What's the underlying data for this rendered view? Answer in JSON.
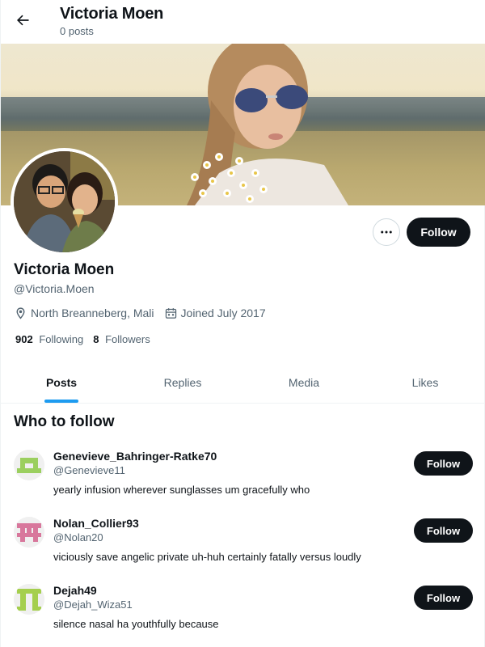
{
  "header": {
    "title": "Victoria Moen",
    "subtitle": "0 posts"
  },
  "profile": {
    "name": "Victoria Moen",
    "handle": "@Victoria.Moen",
    "location": "North Breanneberg, Mali",
    "joined": "Joined July 2017",
    "following_count": "902",
    "following_label": "Following",
    "followers_count": "8",
    "followers_label": "Followers",
    "follow_label": "Follow"
  },
  "tabs": [
    {
      "label": "Posts",
      "active": true
    },
    {
      "label": "Replies",
      "active": false
    },
    {
      "label": "Media",
      "active": false
    },
    {
      "label": "Likes",
      "active": false
    }
  ],
  "who_to_follow": {
    "title": "Who to follow",
    "items": [
      {
        "name": "Genevieve_Bahringer-Ratke70",
        "handle": "@Genevieve11",
        "bio": "yearly infusion wherever sunglasses um gracefully who",
        "follow_label": "Follow",
        "avatar_color": "#9bcf5f"
      },
      {
        "name": "Nolan_Collier93",
        "handle": "@Nolan20",
        "bio": "viciously save angelic private uh-huh certainly fatally versus loudly",
        "follow_label": "Follow",
        "avatar_color": "#d8779c"
      },
      {
        "name": "Dejah49",
        "handle": "@Dejah_Wiza51",
        "bio": "silence nasal ha youthfully because",
        "follow_label": "Follow",
        "avatar_color": "#a5cf4e"
      }
    ]
  },
  "icons": {
    "back": "arrow-left-icon",
    "more": "more-horizontal-icon",
    "location": "location-pin-icon",
    "calendar": "calendar-icon"
  },
  "colors": {
    "accent": "#1d9bf0",
    "button": "#0f1419",
    "secondary_text": "#536471"
  }
}
